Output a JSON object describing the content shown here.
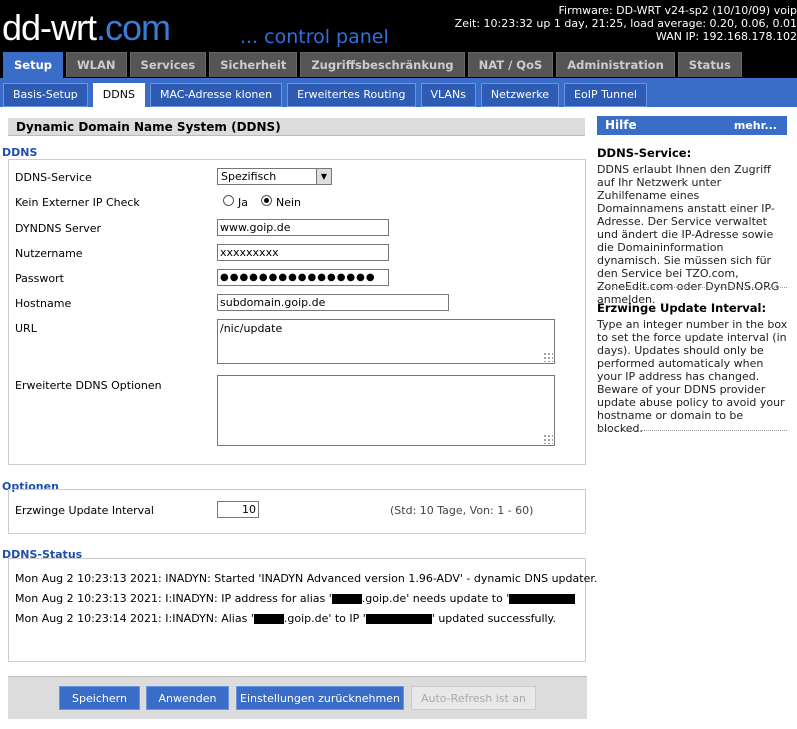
{
  "header": {
    "logo_text": "dd-wrt",
    "logo_dotcom": ".com",
    "logo_panel": "... control panel",
    "firmware": "Firmware: DD-WRT v24-sp2 (10/10/09) voip",
    "time": "Zeit: 10:23:32 up 1 day, 21:25, load average: 0.20, 0.06, 0.01",
    "wan_ip": "WAN IP: 192.168.178.102"
  },
  "main_tabs": [
    "Setup",
    "WLAN",
    "Services",
    "Sicherheit",
    "Zugriffsbeschränkung",
    "NAT / QoS",
    "Administration",
    "Status"
  ],
  "sub_tabs": [
    "Basis-Setup",
    "DDNS",
    "MAC-Adresse klonen",
    "Erweitertes Routing",
    "VLANs",
    "Netzwerke",
    "EoIP Tunnel"
  ],
  "section_title": "Dynamic Domain Name System (DDNS)",
  "ddns": {
    "group_label": "DDNS",
    "service_label": "DDNS-Service",
    "service_value": "Spezifisch",
    "ext_ip_label": "Kein Externer IP Check",
    "ext_ip_yes": "Ja",
    "ext_ip_no": "Nein",
    "ext_ip_selected": "Nein",
    "server_label": "DYNDNS Server",
    "server_value": "www.goip.de",
    "user_label": "Nutzername",
    "user_value": "xxxxxxxxx",
    "pass_label": "Passwort",
    "pass_value": "●●●●●●●●●●●●●●●●",
    "host_label": "Hostname",
    "host_value": "subdomain.goip.de",
    "url_label": "URL",
    "url_value": "/nic/update",
    "adv_label": "Erweiterte DDNS Optionen",
    "adv_value": ""
  },
  "options": {
    "group_label": "Optionen",
    "interval_label": "Erzwinge Update Interval",
    "interval_value": "10",
    "interval_hint": "(Std: 10 Tage, Von: 1 - 60)"
  },
  "status": {
    "group_label": "DDNS-Status",
    "line1": "Mon Aug 2 10:23:13 2021: INADYN: Started 'INADYN Advanced version 1.96-ADV' - dynamic DNS updater.",
    "line2_a": "Mon Aug 2 10:23:13 2021: I:INADYN: IP address for alias '",
    "line2_b": ".goip.de' needs update to '",
    "line3_a": "Mon Aug 2 10:23:14 2021: I:INADYN: Alias '",
    "line3_b": ".goip.de' to IP '",
    "line3_c": "' updated successfully."
  },
  "buttons": {
    "save": "Speichern",
    "apply": "Anwenden",
    "reset": "Einstellungen zurücknehmen",
    "autorefresh": "Auto-Refresh ist an"
  },
  "help": {
    "title": "Hilfe",
    "more": "mehr...",
    "s1_title": "DDNS-Service:",
    "s1_text": "DDNS erlaubt Ihnen den Zugriff auf Ihr Netzwerk unter Zuhilfename eines Domainnamens anstatt einer IP-Adresse. Der Service verwaltet und ändert die IP-Adresse sowie die Domaininformation dynamisch. Sie müssen sich für den Service bei TZO.com, ZoneEdit.com oder DynDNS.ORG anmelden.",
    "s2_title": "Erzwinge Update Interval:",
    "s2_text": "Type an integer number in the box to set the force update interval (in days). Updates should only be performed automaticaly when your IP address has changed. Beware of your DDNS provider update abuse policy to avoid your hostname or domain to be blocked."
  },
  "colors": {
    "accent": "#3a6dc7",
    "header_bg": "#000000",
    "group_label": "#1f4fa8"
  }
}
